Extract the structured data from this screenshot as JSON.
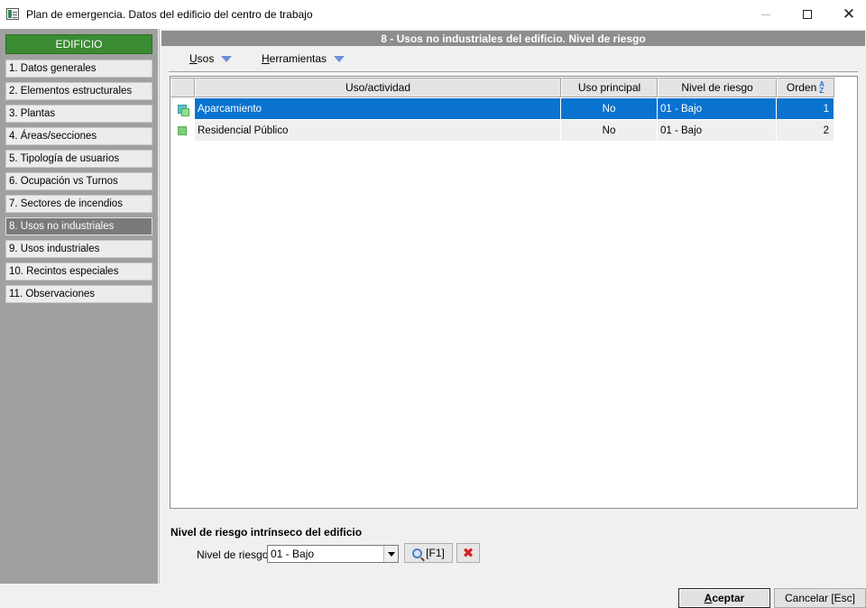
{
  "window": {
    "title": "Plan de emergencia. Datos del edificio del centro de trabajo"
  },
  "sidebar": {
    "header": "EDIFICIO",
    "items": [
      {
        "label": "1. Datos generales"
      },
      {
        "label": "2. Elementos estructurales"
      },
      {
        "label": "3. Plantas"
      },
      {
        "label": "4. Áreas/secciones"
      },
      {
        "label": "5. Tipología de usuarios"
      },
      {
        "label": "6. Ocupación vs Turnos"
      },
      {
        "label": "7. Sectores de incendios"
      },
      {
        "label": "8. Usos no industriales",
        "active": true
      },
      {
        "label": "9. Usos industriales"
      },
      {
        "label": "10. Recintos especiales"
      },
      {
        "label": "11. Observaciones"
      }
    ]
  },
  "main": {
    "header": "8 - Usos no industriales del edificio. Nivel de riesgo",
    "menus": {
      "usos": {
        "accel": "U",
        "rest": "sos"
      },
      "herramientas": {
        "accel": "H",
        "rest": "erramientas"
      }
    },
    "grid": {
      "columns": {
        "uso": "Uso/actividad",
        "principal": "Uso principal",
        "nivel": "Nivel de riesgo",
        "orden": "Orden"
      },
      "rows": [
        {
          "uso": "Aparcamiento",
          "principal": "No",
          "nivel": "01 - Bajo",
          "orden": "1",
          "selected": true
        },
        {
          "uso": "Residencial Público",
          "principal": "No",
          "nivel": "01 - Bajo",
          "orden": "2",
          "selected": false
        }
      ]
    },
    "nivel": {
      "title": "Nivel de riesgo intrínseco del edificio",
      "label": "Nivel de riesgo:",
      "value": "01 - Bajo",
      "search_label": "[F1]"
    }
  },
  "footer": {
    "ok": {
      "accel": "A",
      "rest": "ceptar"
    },
    "cancel": "Cancelar [Esc]"
  },
  "colors": {
    "sidebar_header": "#3b8b33",
    "selection": "#0a73d0",
    "sidebar_bg": "#a0a0a0",
    "panel_header": "#8e8e8e"
  }
}
